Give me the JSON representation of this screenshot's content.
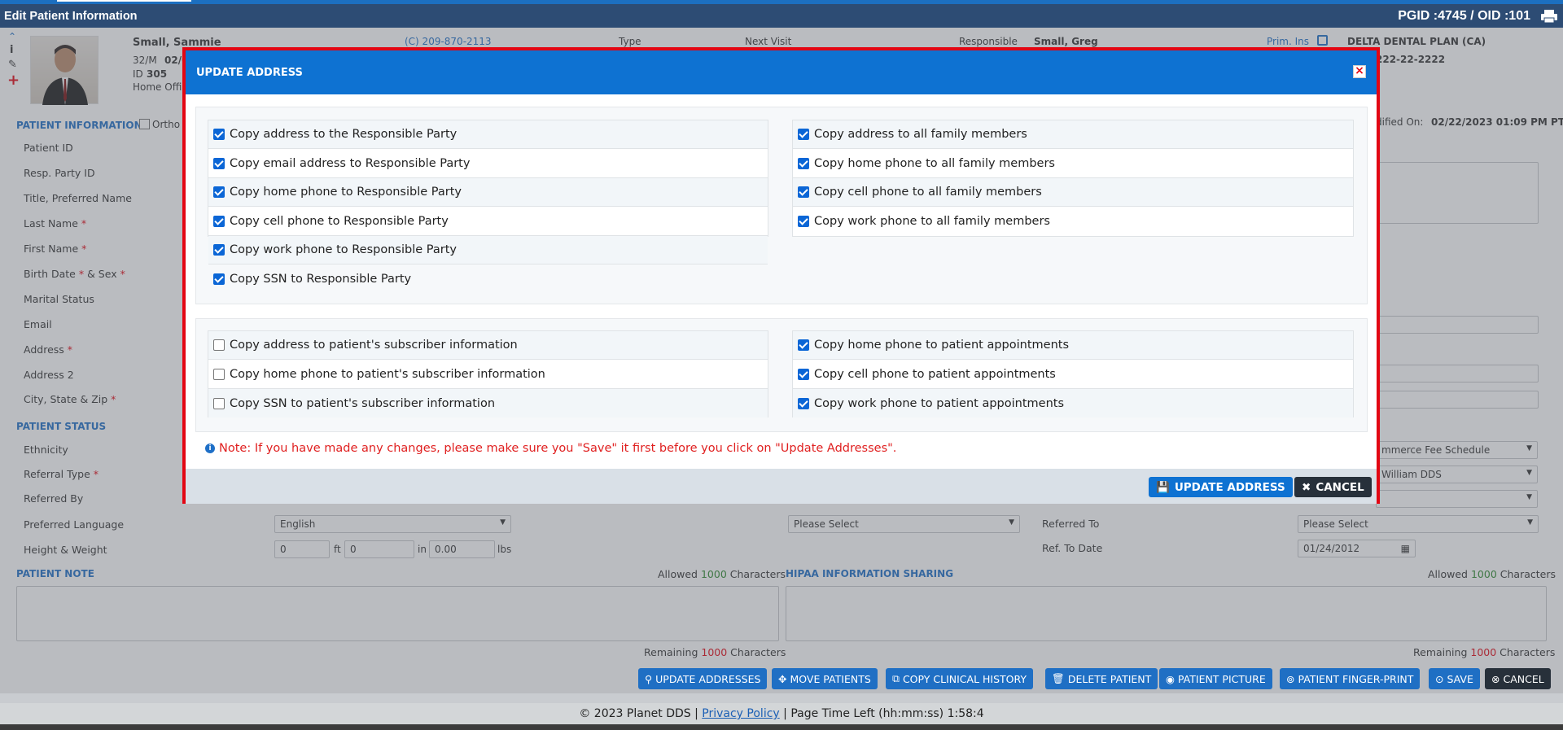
{
  "window": {
    "title": "Edit Patient Information",
    "pgid": "PGID :4745",
    "oid": "OID :101",
    "sep": "/"
  },
  "patient": {
    "name": "Small, Sammie",
    "age_sex": "32/M",
    "dob_partial": "02/0",
    "id_label": "ID",
    "id": "305",
    "office": "Home Offi",
    "phone": "(C)   209-870-2113",
    "type_label": "Type",
    "next_visit_label": "Next Visit",
    "responsible_label": "Responsible",
    "responsible": "Small, Greg",
    "prim_ins_label": "Prim. Ins",
    "insurance": "DELTA DENTAL PLAN (CA)",
    "ins_phone": "222-22-2222",
    "modified_label": "dified On:",
    "modified_value": "02/22/2023 01:09 PM PT"
  },
  "sections": {
    "patient_info": "PATIENT INFORMATION",
    "ortho": "Ortho",
    "patient_status": "PATIENT STATUS",
    "patient_note": "PATIENT NOTE",
    "hipaa": "HIPAA INFORMATION SHARING"
  },
  "fields": {
    "patient_id": "Patient ID",
    "resp_party_id": "Resp. Party ID",
    "title": "Title, Preferred Name",
    "last_name": "Last Name",
    "first_name": "First Name",
    "birth_date": "Birth Date",
    "and_sex": " & Sex",
    "marital": "Marital Status",
    "email": "Email",
    "address": "Address",
    "address2": "Address 2",
    "city": "City, State & Zip",
    "req": " *",
    "ethnicity": "Ethnicity",
    "referral_type": "Referral Type",
    "referred_by": "Referred By",
    "pref_lang": "Preferred Language",
    "height_weight": "Height & Weight"
  },
  "values": {
    "language": "English",
    "ft": "0",
    "ft_unit": "ft",
    "in": "0",
    "in_unit": "in",
    "lbs": "0.00",
    "lbs_unit": "lbs",
    "please_select": "Please Select",
    "please_select2": "Please Select",
    "referred_to": "Referred To",
    "ref_to_date": "Ref. To Date",
    "ref_date": "01/24/2012",
    "fee_schedule": "mmerce Fee Schedule",
    "provider": "William DDS"
  },
  "chars": {
    "allowed": "Allowed",
    "allowed_n": "1000",
    "chars_word": "Characters",
    "remaining": "Remaining",
    "remaining_n": "1000"
  },
  "toolbar": {
    "update_addresses": "UPDATE ADDRESSES",
    "move_patients": "MOVE PATIENTS",
    "copy_clinical": "COPY CLINICAL HISTORY",
    "delete_patient": "DELETE PATIENT",
    "patient_picture": "PATIENT PICTURE",
    "finger_print": "PATIENT FINGER-PRINT",
    "save": "SAVE",
    "cancel": "CANCEL"
  },
  "footer": {
    "copyright": "© 2023 Planet DDS |",
    "privacy": "Privacy Policy",
    "time_left": "|  Page Time Left (hh:mm:ss) 1:58:4"
  },
  "modal": {
    "title": "UPDATE ADDRESS",
    "left_top": [
      {
        "label": "Copy address to the Responsible Party",
        "checked": true
      },
      {
        "label": "Copy email address to Responsible Party",
        "checked": true
      },
      {
        "label": "Copy home phone to Responsible Party",
        "checked": true
      },
      {
        "label": "Copy cell phone to Responsible Party",
        "checked": true
      },
      {
        "label": "Copy work phone to Responsible Party",
        "checked": true
      },
      {
        "label": "Copy SSN to Responsible Party",
        "checked": true
      }
    ],
    "right_top": [
      {
        "label": "Copy address to all family members",
        "checked": true
      },
      {
        "label": "Copy home phone to all family members",
        "checked": true
      },
      {
        "label": "Copy cell phone to all family members",
        "checked": true
      },
      {
        "label": "Copy work phone to all family members",
        "checked": true
      }
    ],
    "left_bottom": [
      {
        "label": "Copy address to patient's subscriber information",
        "checked": false
      },
      {
        "label": "Copy home phone to patient's subscriber information",
        "checked": false
      },
      {
        "label": "Copy SSN to patient's subscriber information",
        "checked": false
      }
    ],
    "right_bottom": [
      {
        "label": "Copy home phone to patient appointments",
        "checked": true
      },
      {
        "label": "Copy cell phone to patient appointments",
        "checked": true
      },
      {
        "label": "Copy work phone to patient appointments",
        "checked": true
      }
    ],
    "note": "Note: If you have made any changes, please make sure you \"Save\" it first before you click on \"Update Addresses\".",
    "update_btn": "UPDATE ADDRESS",
    "cancel_btn": "CANCEL"
  },
  "colors": {
    "brand": "#1f6fc4",
    "titlebar": "#2d4c74",
    "modal_border": "#e30613",
    "note": "#e02020",
    "checkbox": "#0b66d6"
  },
  "icons": [
    "print-icon",
    "collapse-icon",
    "info-icon",
    "attachment-icon",
    "plus-icon",
    "close-icon",
    "save-icon",
    "times-icon",
    "map-marker-icon",
    "move-icon",
    "copy-icon",
    "trash-icon",
    "user-circle-icon",
    "fingerprint-icon",
    "calendar-icon"
  ]
}
